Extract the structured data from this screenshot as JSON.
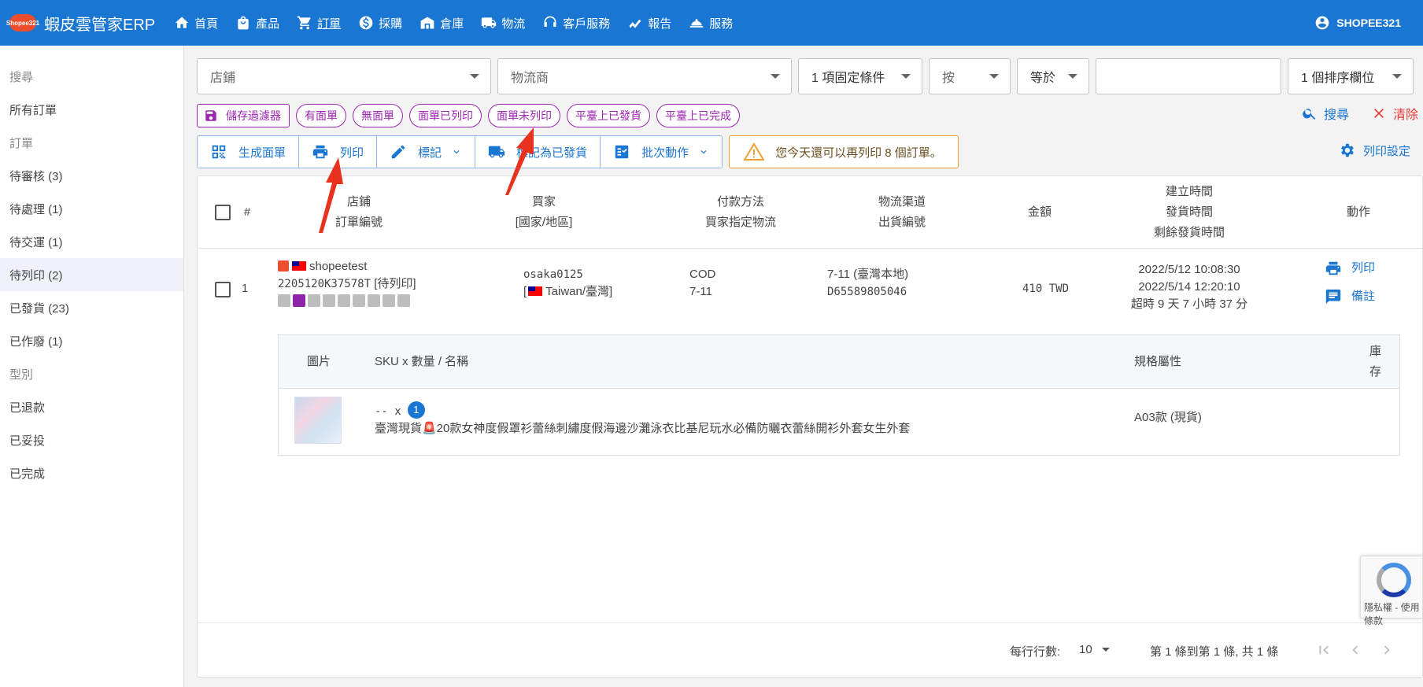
{
  "app": {
    "logo_text": "Shopee321",
    "title": "蝦皮雲管家ERP",
    "nav": [
      {
        "label": "首頁",
        "icon": "home-icon"
      },
      {
        "label": "產品",
        "icon": "shopping-bag-icon"
      },
      {
        "label": "訂單",
        "icon": "cart-icon"
      },
      {
        "label": "採購",
        "icon": "dollar-icon"
      },
      {
        "label": "倉庫",
        "icon": "warehouse-icon"
      },
      {
        "label": "物流",
        "icon": "truck-icon"
      },
      {
        "label": "客戶服務",
        "icon": "support-icon"
      },
      {
        "label": "報告",
        "icon": "chart-icon"
      },
      {
        "label": "服務",
        "icon": "service-icon"
      }
    ],
    "user": "SHOPEE321"
  },
  "sidebar": {
    "items": [
      {
        "label": "搜尋",
        "type": "section"
      },
      {
        "label": "所有訂單",
        "type": "item"
      },
      {
        "label": "訂單",
        "type": "section"
      },
      {
        "label": "待審核 (3)",
        "type": "item"
      },
      {
        "label": "待處理 (1)",
        "type": "item"
      },
      {
        "label": "待交運 (1)",
        "type": "item"
      },
      {
        "label": "待列印 (2)",
        "type": "item",
        "active": true
      },
      {
        "label": "已發貨 (23)",
        "type": "item"
      },
      {
        "label": "已作廢 (1)",
        "type": "item"
      },
      {
        "label": "型別",
        "type": "section"
      },
      {
        "label": "已退款",
        "type": "item"
      },
      {
        "label": "已妥投",
        "type": "item"
      },
      {
        "label": "已完成",
        "type": "item"
      }
    ]
  },
  "filters": {
    "shop": "店鋪",
    "carrier": "物流商",
    "fixed_condition": "1 項固定條件",
    "by": "按",
    "equals": "等於",
    "value": "",
    "sort": "1 個排序欄位"
  },
  "chips": {
    "save": "儲存過濾器",
    "items": [
      "有面單",
      "無面單",
      "面單已列印",
      "面單未列印",
      "平臺上已發貨",
      "平臺上已完成"
    ],
    "search": "搜尋",
    "clear": "清除"
  },
  "actions": {
    "generate": "生成面單",
    "print": "列印",
    "mark": "標記",
    "mark_shipped": "標記為已發貨",
    "batch": "批次動作",
    "warning": "您今天還可以再列印 8 個訂單。",
    "print_settings": "列印設定"
  },
  "table": {
    "headers": {
      "index": "#",
      "shop": "店鋪",
      "order_no": "訂單編號",
      "buyer": "買家",
      "region": "[國家/地區]",
      "payment": "付款方法",
      "buyer_logistics": "買家指定物流",
      "channel": "物流渠道",
      "shipment_no": "出貨編號",
      "amount": "金額",
      "created": "建立時間",
      "shipped": "發貨時間",
      "remaining": "剩餘發貨時間",
      "action": "動作"
    },
    "row": {
      "index": "1",
      "shop": "shopeetest",
      "order_no": "2205120K37578T",
      "order_status": "[待列印]",
      "buyer": "osaka0125",
      "region": "Taiwan/臺灣",
      "payment": "COD",
      "buyer_logistics": "7-11",
      "channel": "7-11 (臺灣本地)",
      "shipment_no": "D65589805046",
      "amount": "410 TWD",
      "created": "2022/5/12 10:08:30",
      "shipped": "2022/5/14 12:20:10",
      "remaining": "超時 9 天 7 小時 37 分",
      "action_print": "列印",
      "action_note": "備註"
    },
    "sub_headers": {
      "image": "圖片",
      "sku": "SKU x 數量 / 名稱",
      "spec": "規格屬性",
      "stock": "庫存"
    },
    "sub_row": {
      "sku": "-- x",
      "qty": "1",
      "name": "臺灣現貨🚨20款女神度假罩衫蕾絲刺繡度假海邊沙灘泳衣比基尼玩水必備防曬衣蕾絲開衫外套女生外套",
      "spec": "A03款 (現貨)"
    }
  },
  "pager": {
    "rows_label": "每行行數:",
    "rows_value": "10",
    "range": "第 1 條到第 1 條, 共 1 條"
  },
  "recaptcha": {
    "text": "隱私權 - 使用條款"
  }
}
